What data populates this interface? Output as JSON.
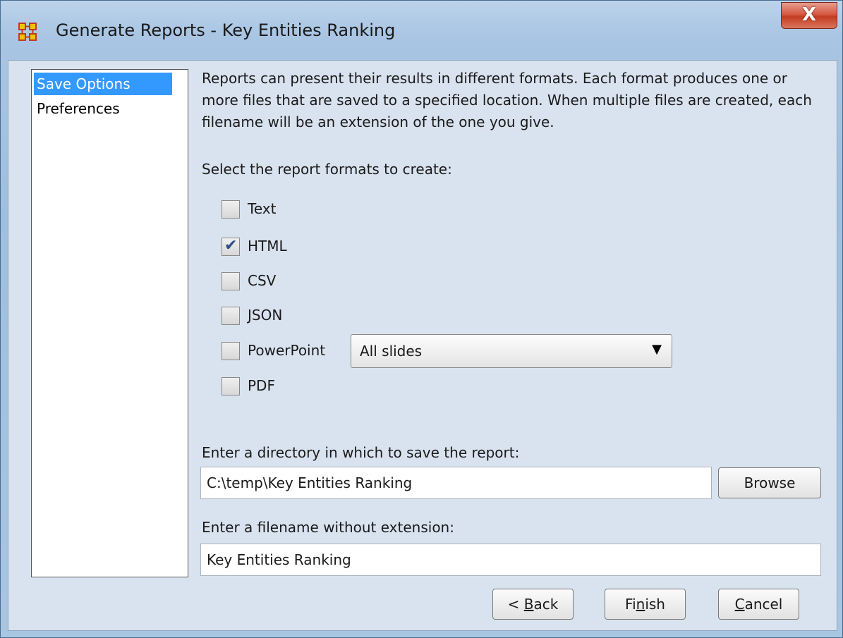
{
  "window": {
    "title": "Generate Reports - Key Entities Ranking",
    "close_label": "X",
    "app_icon": "meta-network-icon"
  },
  "nav": {
    "items": [
      {
        "label": "Save Options",
        "selected": true
      },
      {
        "label": "Preferences",
        "selected": false
      }
    ]
  },
  "description": "Reports can present their results in different formats. Each format produces one or more files that are saved to a specified location. When multiple files are created, each filename will be an extension of the one you give.",
  "formats": {
    "prompt": "Select the report formats to create:",
    "options": [
      {
        "label": "Text",
        "checked": false
      },
      {
        "label": "HTML",
        "checked": true
      },
      {
        "label": "CSV",
        "checked": false
      },
      {
        "label": "JSON",
        "checked": false
      },
      {
        "label": "PowerPoint",
        "checked": false
      },
      {
        "label": "PDF",
        "checked": false
      }
    ],
    "powerpoint_select": "All slides"
  },
  "directory": {
    "label": "Enter a directory in which to save the report:",
    "value": "C:\\temp\\Key Entities Ranking",
    "browse_label": "Browse"
  },
  "filename": {
    "label": "Enter a filename without extension:",
    "value": "Key Entities Ranking"
  },
  "buttons": {
    "back_prefix": "< ",
    "back_mnemonic": "B",
    "back_rest": "ack",
    "finish_prefix": "Fi",
    "finish_mnemonic": "n",
    "finish_rest": "ish",
    "cancel_mnemonic": "C",
    "cancel_rest": "ancel"
  },
  "colors": {
    "selection": "#3399ff",
    "close_button": "#c43c22",
    "panel_background": "#d9e3ef"
  }
}
